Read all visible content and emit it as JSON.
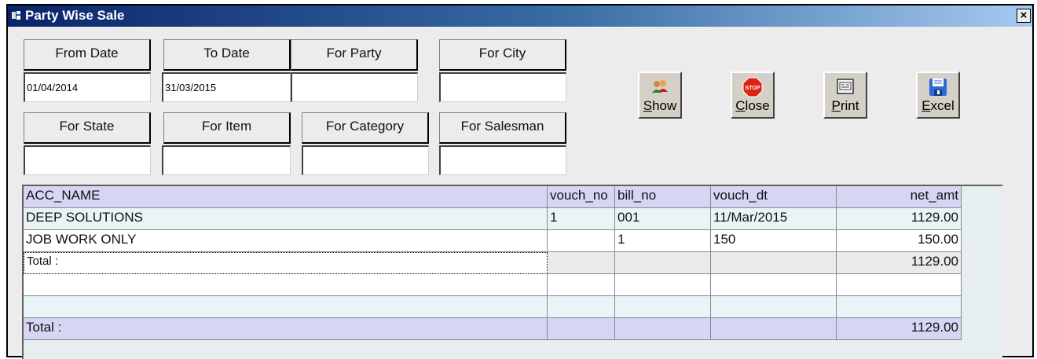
{
  "window": {
    "title": "Party Wise Sale",
    "close_glyph": "×"
  },
  "filters": {
    "from_date": {
      "label": "From Date",
      "value": "01/04/2014"
    },
    "to_date": {
      "label": "To Date",
      "value": "31/03/2015"
    },
    "for_party": {
      "label": "For Party",
      "value": ""
    },
    "for_city": {
      "label": "For City",
      "value": ""
    },
    "for_state": {
      "label": "For State",
      "value": ""
    },
    "for_item": {
      "label": "For Item",
      "value": ""
    },
    "for_category": {
      "label": "For Category",
      "value": ""
    },
    "for_salesman": {
      "label": "For Salesman",
      "value": ""
    }
  },
  "buttons": {
    "show": {
      "mnemonic": "S",
      "rest": "how",
      "icon": "users-icon"
    },
    "close": {
      "mnemonic": "C",
      "rest": "lose",
      "icon": "stop-icon",
      "icon_text": "STOP"
    },
    "print": {
      "mnemonic": "P",
      "rest": "rint",
      "icon": "printer-icon"
    },
    "excel": {
      "mnemonic": "E",
      "rest": "xcel",
      "icon": "floppy-disk-icon"
    }
  },
  "grid": {
    "columns": [
      "ACC_NAME",
      "vouch_no",
      "bill_no",
      "vouch_dt",
      "net_amt"
    ],
    "rows": [
      [
        "DEEP SOLUTIONS",
        "1",
        "001",
        "11/Mar/2015",
        "1129.00"
      ],
      [
        "JOB WORK ONLY",
        "",
        "1",
        "150",
        "150.00"
      ]
    ],
    "subtotal": {
      "label": "Total :",
      "net_amt": "1129.00"
    },
    "footer": {
      "label": "Total :",
      "net_amt": "1129.00"
    }
  },
  "colors": {
    "title_start": "#0a246a",
    "title_end": "#a6caf0",
    "header_row": "#d6d6f4",
    "stop_red": "#e02010"
  }
}
